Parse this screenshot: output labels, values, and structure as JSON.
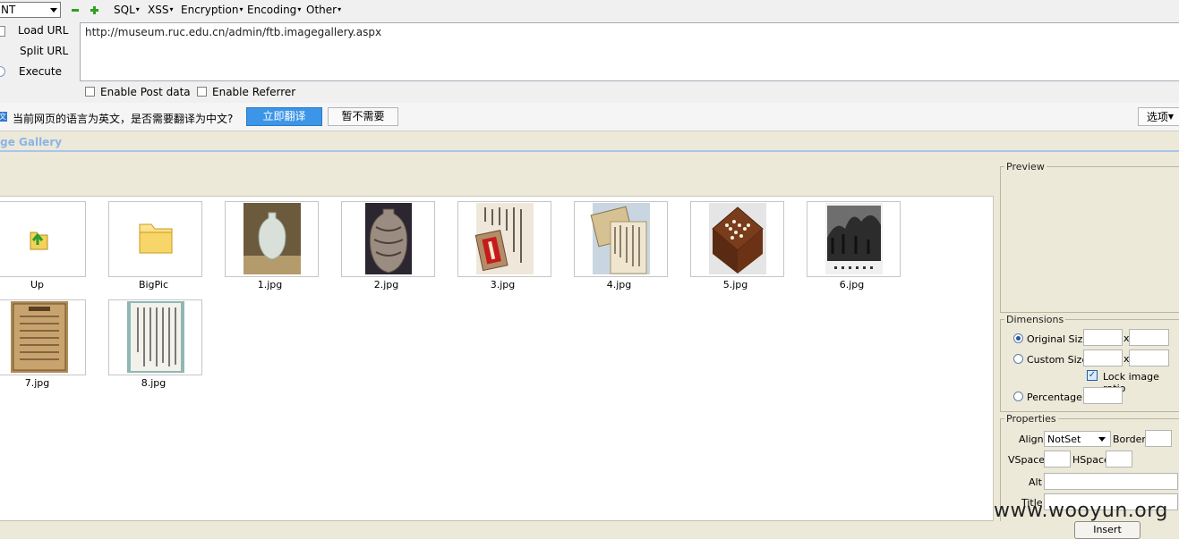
{
  "hackbar": {
    "combo_value": "NT",
    "menus": [
      "SQL",
      "XSS",
      "Encryption",
      "Encoding",
      "Other"
    ],
    "side_buttons": [
      "Load URL",
      "Split URL",
      "Execute"
    ],
    "url": "http://museum.ruc.edu.cn/admin/ftb.imagegallery.aspx",
    "enable_post_label": "Enable Post data",
    "enable_referrer_label": "Enable Referrer"
  },
  "translate_bar": {
    "message": "当前网页的语言为英文，是否需要翻译为中文?",
    "translate_button": "立即翻译",
    "not_now_button": "暂不需要",
    "options_button": "选项"
  },
  "gallery": {
    "title": "age Gallery",
    "items": [
      {
        "name": "Up",
        "kind": "up-folder"
      },
      {
        "name": "BigPic",
        "kind": "folder"
      },
      {
        "name": "1.jpg",
        "kind": "vase-white"
      },
      {
        "name": "2.jpg",
        "kind": "vase-patterned"
      },
      {
        "name": "3.jpg",
        "kind": "calligraphy-with-seal"
      },
      {
        "name": "4.jpg",
        "kind": "letters"
      },
      {
        "name": "5.jpg",
        "kind": "go-board"
      },
      {
        "name": "6.jpg",
        "kind": "bw-photo"
      },
      {
        "name": "7.jpg",
        "kind": "old-document"
      },
      {
        "name": "8.jpg",
        "kind": "calligraphy-scroll"
      }
    ]
  },
  "panel": {
    "preview_legend": "Preview",
    "dimensions_legend": "Dimensions",
    "original_size_label": "Original Size",
    "custom_size_label": "Custom Size",
    "x_label": "x",
    "lock_ratio_label": "Lock image ratio",
    "percentage_label": "Percentage",
    "properties_legend": "Properties",
    "align_label": "Align",
    "align_value": "NotSet",
    "border_label": "Border",
    "vspace_label": "VSpace",
    "hspace_label": "HSpace",
    "alt_label": "Alt",
    "title_label": "Title"
  },
  "insert_button": "Insert",
  "watermark": "www.wooyun.org",
  "colors": {
    "translate_button": "#3c95e6",
    "gallery_title": "#8ab4e8",
    "panel_bg": "#ece9d8"
  }
}
